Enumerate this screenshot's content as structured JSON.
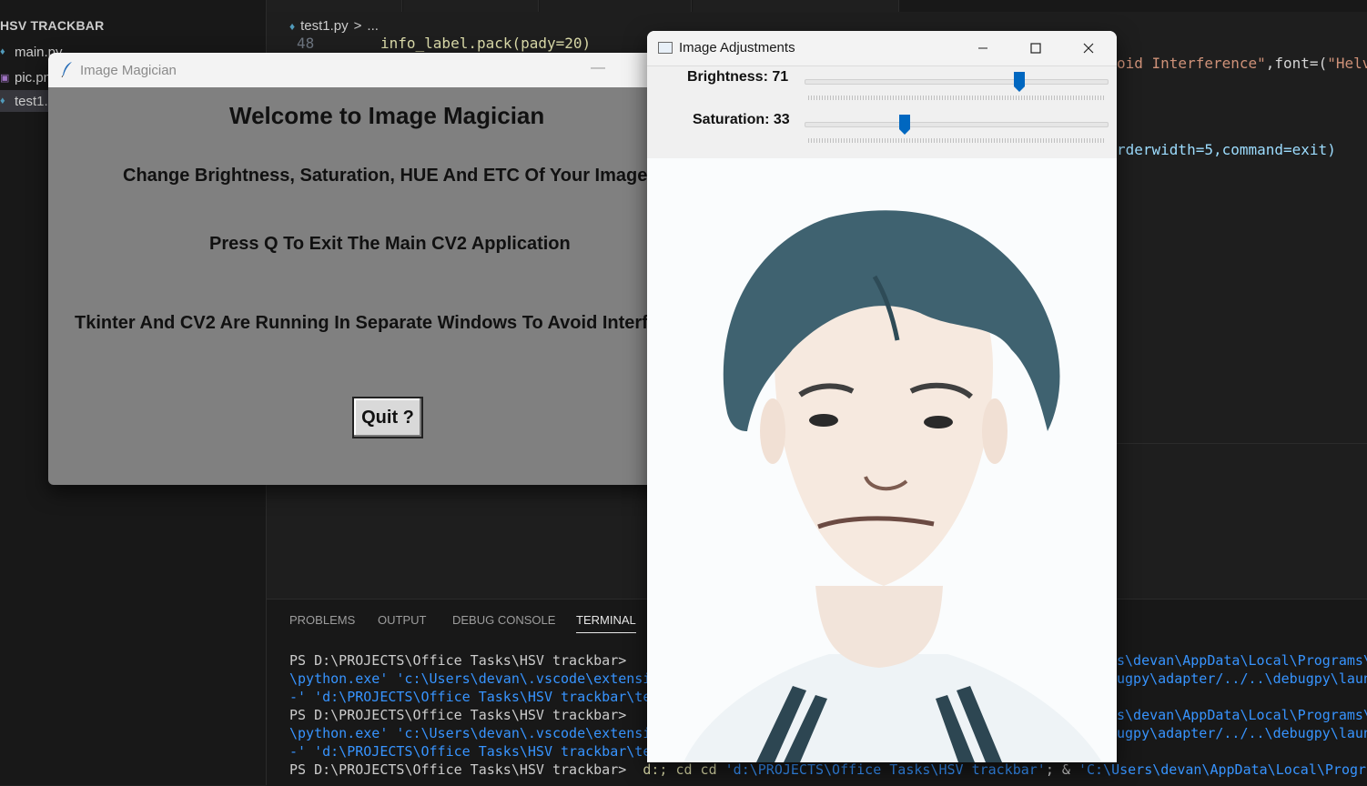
{
  "vscode": {
    "explorer_title": "HSV TRACKBAR",
    "files": [
      {
        "name": "main.py",
        "icon": "python-file-icon"
      },
      {
        "name": "pic.pn",
        "icon": "image-file-icon"
      },
      {
        "name": "test1.",
        "icon": "python-file-icon"
      }
    ],
    "breadcrumb": {
      "file": "test1.py",
      "sep": ">",
      "more": "..."
    },
    "code_lines": [
      {
        "num": "48",
        "text": "info_label.pack(pady=20)"
      }
    ],
    "right_code_1a": "oid Interference\"",
    "right_code_1b": ",font=(",
    "right_code_1c": "\"Helv",
    "right_code_2": "rderwidth=5,command=exit)",
    "panel_tabs": [
      "PROBLEMS",
      "OUTPUT",
      "DEBUG CONSOLE",
      "TERMINAL"
    ],
    "terminal": {
      "l1": "PS D:\\PROJECTS\\Office Tasks\\HSV trackbar>",
      "l1r": "s\\devan\\AppData\\Local\\Programs\\",
      "l2": "\\python.exe' 'c:\\Users\\devan\\.vscode\\extensi",
      "l2r": "ugpy\\adapter/../..\\debugpy\\laun",
      "l3": "-' 'd:\\PROJECTS\\Office Tasks\\HSV trackbar\\te",
      "l4": "PS D:\\PROJECTS\\Office Tasks\\HSV trackbar>",
      "l4r": "s\\devan\\AppData\\Local\\Programs\\",
      "l5": "\\python.exe' 'c:\\Users\\devan\\.vscode\\extensi",
      "l5r": "ugpy\\adapter/../..\\debugpy\\laun",
      "l6": "-' 'd:\\PROJECTS\\Office Tasks\\HSV trackbar\\te",
      "l7a": "PS D:\\PROJECTS\\Office Tasks\\HSV trackbar>",
      "l7b": "d:; cd",
      "l7c": "'d:\\PROJECTS\\Office Tasks\\HSV trackbar'",
      "l7d": "; &",
      "l7e": "'C:\\Users\\devan\\AppData\\Local\\Programs\\"
    }
  },
  "magician": {
    "title": "Image Magician",
    "heading": "Welcome to Image Magician",
    "line1": "Change Brightness, Saturation, HUE And ETC Of Your Image",
    "line2": "Press Q To Exit The Main CV2 Application",
    "line3": "Tkinter And CV2 Are Running In Separate Windows To Avoid Interf",
    "quit_label": "Quit ?"
  },
  "adjust": {
    "title": "Image Adjustments",
    "brightness_label": "Brightness: 71",
    "brightness_value": 71,
    "saturation_label": "Saturation: 33",
    "saturation_value": 33,
    "slider_max": 100,
    "accent": "#0067c0"
  }
}
